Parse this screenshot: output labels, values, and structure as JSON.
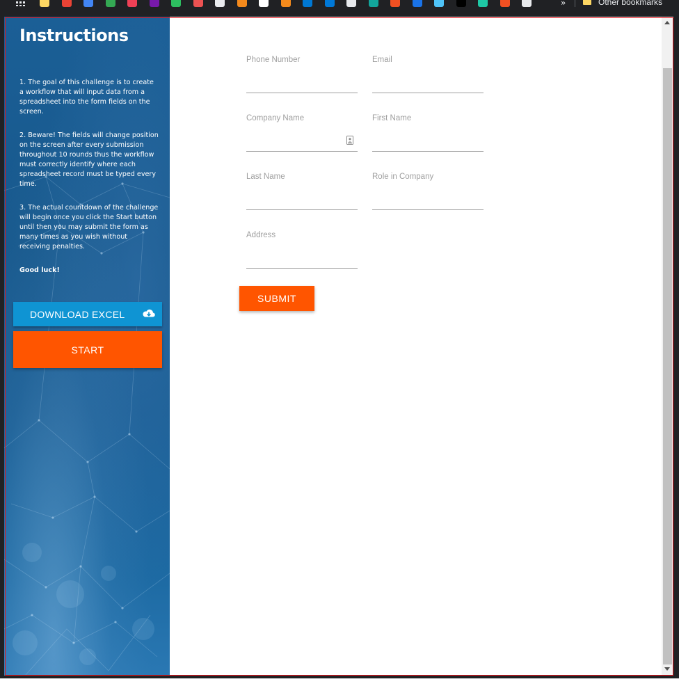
{
  "bookmarks_bar": {
    "icons": [
      {
        "name": "apps-grid-icon",
        "color": "#e8eaed"
      },
      {
        "name": "folder-bookmark-icon",
        "color": "#fdd663"
      },
      {
        "name": "gmail-icon",
        "color": "#ea4335"
      },
      {
        "name": "calendar-icon",
        "color": "#4285f4"
      },
      {
        "name": "sheets-icon",
        "color": "#34a853"
      },
      {
        "name": "pocket-icon",
        "color": "#ef4056"
      },
      {
        "name": "onenote-icon",
        "color": "#7719aa"
      },
      {
        "name": "evernote-icon",
        "color": "#2dbe60"
      },
      {
        "name": "udemy-icon",
        "color": "#ec5252"
      },
      {
        "name": "person-icon",
        "color": "#e8eaed"
      },
      {
        "name": "orange-cube-icon",
        "color": "#f48a1c"
      },
      {
        "name": "amazon-icon",
        "color": "#ffffff"
      },
      {
        "name": "orange-cube-icon-2",
        "color": "#f48a1c"
      },
      {
        "name": "azure-icon",
        "color": "#0078d4"
      },
      {
        "name": "devops-icon",
        "color": "#0078d7"
      },
      {
        "name": "github-icon",
        "color": "#e8eaed"
      },
      {
        "name": "teal-drop-icon",
        "color": "#12a59b"
      },
      {
        "name": "microsoft-icon",
        "color": "#f25022"
      },
      {
        "name": "blue-diamond-icon",
        "color": "#1a73e8"
      },
      {
        "name": "smiley-icon",
        "color": "#4fc3f7"
      },
      {
        "name": "r-icon",
        "color": "#000000"
      },
      {
        "name": "e-icon",
        "color": "#1ec8a5"
      },
      {
        "name": "microsoft-icon-2",
        "color": "#f25022"
      },
      {
        "name": "rocket-icon",
        "color": "#e8eaed"
      }
    ],
    "more": "»",
    "other_bookmarks": "Other bookmarks"
  },
  "sidebar": {
    "title": "Instructions",
    "paragraphs": [
      "1. The goal of this challenge is to create a workflow that will input data from a spreadsheet into the form fields on the screen.",
      "2. Beware! The fields will change position on the screen after every submission throughout 10 rounds thus the workflow must correctly identify where each spreadsheet record must be typed every time.",
      "3. The actual countdown of the challenge will begin once you click the Start button until then you may submit the form as many times as you wish without receiving penalties.",
      "Good luck!"
    ],
    "download_label": "DOWNLOAD EXCEL",
    "start_label": "START"
  },
  "form": {
    "fields": [
      {
        "label": "Phone Number",
        "value": ""
      },
      {
        "label": "Email",
        "value": ""
      },
      {
        "label": "Company Name",
        "value": ""
      },
      {
        "label": "First Name",
        "value": ""
      },
      {
        "label": "Last Name",
        "value": ""
      },
      {
        "label": "Role in Company",
        "value": ""
      },
      {
        "label": "Address",
        "value": ""
      }
    ],
    "submit_label": "SUBMIT"
  },
  "colors": {
    "accent": "#ff5500",
    "download_button": "#0f94d3",
    "sidebar": "#1b5f96",
    "frame_border": "#e0151d"
  }
}
